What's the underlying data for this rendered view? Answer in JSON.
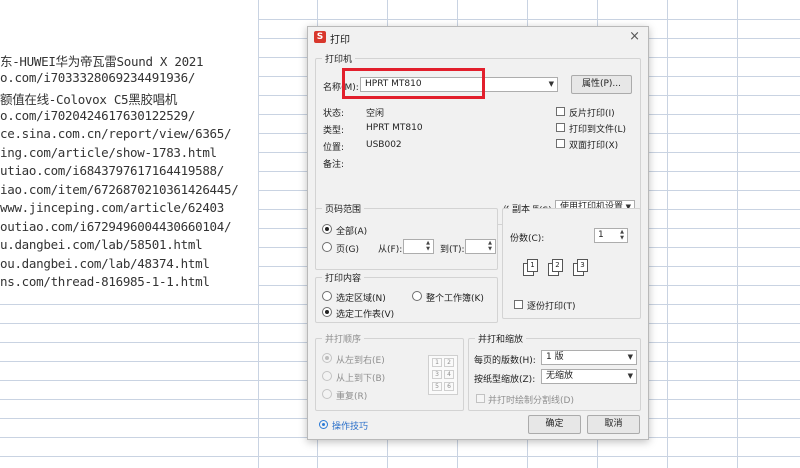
{
  "sheet": {
    "lines": [
      "东-HUWEI华为帝瓦雷Sound X 2021",
      "o.com/i7033328069234491936/",
      "额值在线-Colovox C5黑胶唱机",
      "o.com/i7020424617630122529/",
      "ce.sina.com.cn/report/view/6365/",
      "ing.com/article/show-1783.html",
      "utiao.com/i6843797617164419588/",
      "iao.com/item/6726870210361426445/",
      "www.jinceping.com/article/62403",
      "outiao.com/i6729496004430660104/",
      "u.dangbei.com/lab/58501.html",
      "ou.dangbei.com/lab/48374.html",
      "ns.com/thread-816985-1-1.html"
    ]
  },
  "dialog": {
    "logo": "S",
    "title": "打印",
    "close": "×",
    "printer": {
      "legend": "打印机",
      "name_label": "名称(M):",
      "name_value": "HPRT MT810",
      "properties_button": "属性(P)...",
      "status_label": "状态:",
      "status_value": "空闲",
      "type_label": "类型:",
      "type_value": "HPRT MT810",
      "location_label": "位置:",
      "location_value": "USB002",
      "comment_label": "备注:",
      "reverse_print": "反片打印(I)",
      "print_to_file": "打印到文件(L)",
      "duplex": "双面打印(X)",
      "paper_source_label": "纸张来源(S):",
      "paper_source_value": "使用打印机设置"
    },
    "page_range": {
      "legend": "页码范围",
      "all": "全部(A)",
      "pages": "页(G)",
      "from_label": "从(F):",
      "from_value": "",
      "to_label": "到(T):",
      "to_value": ""
    },
    "copies": {
      "legend": "副本",
      "count_label": "份数(C):",
      "count_value": "1",
      "collate": "逐份打印(T)",
      "icon_labels": [
        "1",
        "2",
        "3"
      ]
    },
    "print_content": {
      "legend": "打印内容",
      "selection": "选定区域(N)",
      "whole_workbook": "整个工作簿(K)",
      "selected_sheet": "选定工作表(V)"
    },
    "order": {
      "legend": "并打顺序",
      "left_to_right": "从左到右(E)",
      "top_to_bottom": "从上到下(B)",
      "repeat": "重复(R)",
      "grid": [
        "1",
        "2",
        "3",
        "4",
        "5",
        "6"
      ]
    },
    "scale": {
      "legend": "并打和缩放",
      "pages_per_sheet_label": "每页的版数(H):",
      "pages_per_sheet_value": "1 版",
      "scale_to_paper_label": "按纸型缩放(Z):",
      "scale_to_paper_value": "无缩放",
      "draw_borders": "并打时绘制分割线(D)"
    },
    "tips_link": "操作技巧",
    "ok_button": "确定",
    "cancel_button": "取消"
  }
}
